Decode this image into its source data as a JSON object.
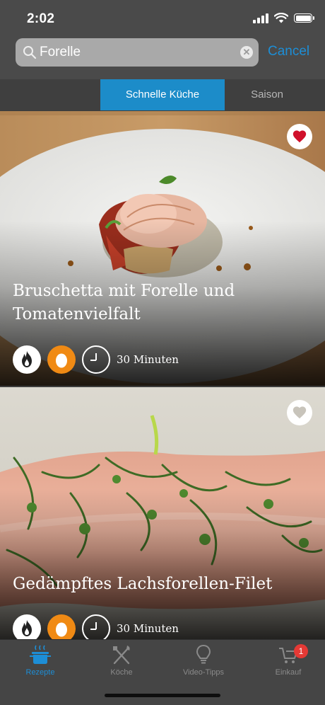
{
  "status": {
    "time": "2:02"
  },
  "search": {
    "value": "Forelle",
    "cancel_label": "Cancel"
  },
  "category_tabs": [
    {
      "label": "Schnelle Küche",
      "active": true
    },
    {
      "label": "Saison",
      "active": false
    }
  ],
  "recipes": [
    {
      "title": "Bruschetta mit Forelle und Tomatenvielfalt",
      "duration": "30 Minuten",
      "favorite": true,
      "badges": [
        "flame-icon",
        "egg-icon"
      ]
    },
    {
      "title": "Gedämpftes Lachsforellen-Filet",
      "duration": "30 Minuten",
      "favorite": false,
      "badges": [
        "flame-icon",
        "egg-icon"
      ]
    }
  ],
  "tabbar": {
    "items": [
      {
        "label": "Rezepte",
        "icon": "pot-icon",
        "active": true
      },
      {
        "label": "Köche",
        "icon": "utensils-icon",
        "active": false
      },
      {
        "label": "Video-Tipps",
        "icon": "lightbulb-icon",
        "active": false
      },
      {
        "label": "Einkauf",
        "icon": "cart-icon",
        "active": false,
        "badge": "1"
      }
    ]
  },
  "colors": {
    "accent": "#1c8cc9",
    "favorite": "#d0102b",
    "badge_orange": "#f08a14",
    "cart_badge": "#e53935"
  }
}
